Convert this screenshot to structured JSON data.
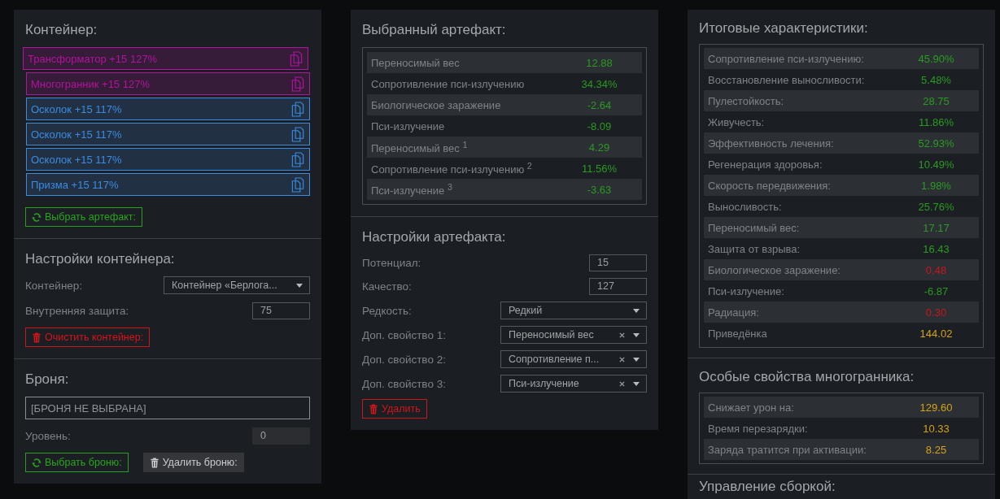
{
  "container_panel": {
    "title": "Контейнер:",
    "artifacts": [
      {
        "label": "Трансформатор +15 127%",
        "color": "#b1149e",
        "selected": true
      },
      {
        "label": "Многогранник +15 127%",
        "color": "#b1149e",
        "selected": false
      },
      {
        "label": "Осколок +15 117%",
        "color": "#3b8be0",
        "selected": false
      },
      {
        "label": "Осколок +15 117%",
        "color": "#3b8be0",
        "selected": false
      },
      {
        "label": "Осколок +15 117%",
        "color": "#3b8be0",
        "selected": false
      },
      {
        "label": "Призма +15 117%",
        "color": "#3b8be0",
        "selected": false
      }
    ],
    "select_button": {
      "label": "Выбрать артефакт:",
      "kind": "success"
    }
  },
  "container_settings": {
    "title": "Настройки контейнера:",
    "fields": [
      {
        "kind": "select",
        "label": "Контейнер:",
        "value": "Контейнер «Берлога..."
      },
      {
        "kind": "number",
        "label": "Внутренняя защита:",
        "value": "75"
      }
    ],
    "clear_button": {
      "label": "Очистить контейнер:",
      "kind": "danger"
    }
  },
  "armor": {
    "title": "Броня:",
    "armor_field": "[БРОНЯ НЕ ВЫБРАНА]",
    "level": {
      "label": "Уровень:",
      "value": "0",
      "disabled": true
    },
    "buttons": [
      {
        "label": "Выбрать броню:",
        "kind": "success"
      },
      {
        "label": "Удалить броню:",
        "kind": "secondary"
      }
    ]
  },
  "selected_artifact": {
    "title": "Выбранный артефакт:",
    "stats": [
      {
        "name": "Переносимый вес",
        "value": "12.88",
        "color": "#2a9b22"
      },
      {
        "name": "Сопротивление пси-излучению",
        "value": "34.34%",
        "color": "#2a9b22"
      },
      {
        "name": "Биологическое заражение",
        "value": "-2.64",
        "color": "#2a9b22"
      },
      {
        "name": "Пси-излучение",
        "value": "-8.09",
        "color": "#2a9b22"
      },
      {
        "name": "Переносимый вес $^{1}$",
        "value": "4.29",
        "color": "#2a9b22"
      },
      {
        "name": "Сопротивление пси-излучению $^{2}$",
        "value": "11.56%",
        "color": "#2a9b22"
      },
      {
        "name": "Пси-излучение $^{3}$",
        "value": "-3.63",
        "color": "#2a9b22"
      }
    ]
  },
  "artifact_settings": {
    "title": "Настройки артефакта:",
    "fields": [
      {
        "kind": "number",
        "label": "Потенциал:",
        "value": "15"
      },
      {
        "kind": "number",
        "label": "Качество:",
        "value": "127"
      },
      {
        "kind": "select",
        "label": "Редкость:",
        "value": "Редкий",
        "clearable": false
      },
      {
        "kind": "select",
        "label": "Доп. свойство 1:",
        "value": "Переносимый вес",
        "clearable": true
      },
      {
        "kind": "select",
        "label": "Доп. свойство 2:",
        "value": "Сопротивление п...",
        "clearable": true
      },
      {
        "kind": "select",
        "label": "Доп. свойство 3:",
        "value": "Пси-излучение",
        "clearable": true
      }
    ],
    "delete_button": {
      "label": "Удалить",
      "kind": "danger"
    }
  },
  "totals": {
    "title": "Итоговые характеристики:",
    "stats": [
      {
        "name": "Сопротивление пси-излучению:",
        "value": "45.90%",
        "color": "#2a9b22"
      },
      {
        "name": "Восстановление выносливости:",
        "value": "5.48%",
        "color": "#2a9b22"
      },
      {
        "name": "Пулестойкость:",
        "value": "28.75",
        "color": "#2a9b22"
      },
      {
        "name": "Живучесть:",
        "value": "11.86%",
        "color": "#2a9b22"
      },
      {
        "name": "Эффективность лечения:",
        "value": "52.93%",
        "color": "#2a9b22"
      },
      {
        "name": "Регенерация здоровья:",
        "value": "10.49%",
        "color": "#2a9b22"
      },
      {
        "name": "Скорость передвижения:",
        "value": "1.98%",
        "color": "#2a9b22"
      },
      {
        "name": "Выносливость:",
        "value": "25.76%",
        "color": "#2a9b22"
      },
      {
        "name": "Переносимый вес:",
        "value": "17.17",
        "color": "#2a9b22"
      },
      {
        "name": "Защита от взрыва:",
        "value": "16.43",
        "color": "#2a9b22"
      },
      {
        "name": "Биологическое заражение:",
        "value": "0.48",
        "color": "#c8171c"
      },
      {
        "name": "Пси-излучение:",
        "value": "-6.87",
        "color": "#2a9b22"
      },
      {
        "name": "Радиация:",
        "value": "0.30",
        "color": "#c8171c"
      },
      {
        "name": "Приведёнка",
        "value": "144.02",
        "color": "#d4a317"
      }
    ]
  },
  "polyhedron": {
    "title": "Особые свойства многогранника:",
    "stats": [
      {
        "name": "Снижает урон на:",
        "value": "129.60",
        "color": "#d4a317"
      },
      {
        "name": "Время перезарядки:",
        "value": "10.33",
        "color": "#d4a317"
      },
      {
        "name": "Заряда тратится при активации:",
        "value": "8.25",
        "color": "#d4a317"
      }
    ]
  },
  "build_management": {
    "title": "Управление сборкой:"
  }
}
